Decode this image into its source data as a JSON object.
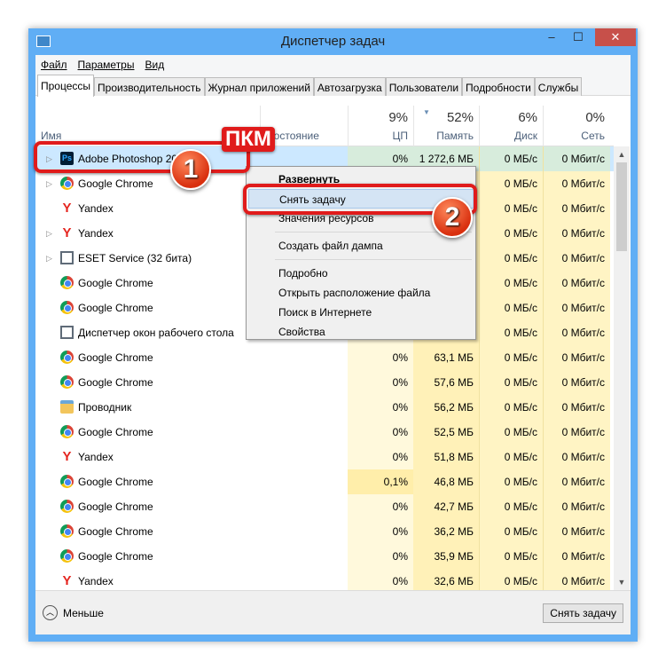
{
  "window": {
    "title": "Диспетчер задач",
    "minimize": "–",
    "maximize": "☐",
    "close": "✕"
  },
  "menu": [
    "Файл",
    "Параметры",
    "Вид"
  ],
  "tabs": [
    "Процессы",
    "Производительность",
    "Журнал приложений",
    "Автозагрузка",
    "Пользователи",
    "Подробности",
    "Службы"
  ],
  "header": {
    "name": "Имя",
    "status": "Состояние",
    "cpu_pct": "9%",
    "cpu": "ЦП",
    "mem_pct": "52%",
    "mem": "Память",
    "disk_pct": "6%",
    "disk": "Диск",
    "net_pct": "0%",
    "net": "Сеть"
  },
  "rows": [
    {
      "name": "Adobe Photoshop 2020",
      "icon": "ps",
      "expand": true,
      "cpu": "0%",
      "mem": "1 272,6 МБ",
      "disk": "0 МБ/с",
      "net": "0 Мбит/с",
      "selected": true
    },
    {
      "name": "Google Chrome",
      "icon": "chrome",
      "expand": true,
      "cpu": "",
      "mem": "",
      "disk": "0 МБ/с",
      "net": "0 Мбит/с"
    },
    {
      "name": "Yandex",
      "icon": "yandex",
      "expand": false,
      "cpu": "",
      "mem": "",
      "disk": "0 МБ/с",
      "net": "0 Мбит/с"
    },
    {
      "name": "Yandex",
      "icon": "yandex",
      "expand": true,
      "cpu": "",
      "mem": "",
      "disk": "0 МБ/с",
      "net": "0 Мбит/с"
    },
    {
      "name": "ESET Service (32 бита)",
      "icon": "app",
      "expand": true,
      "cpu": "",
      "mem": "",
      "disk": "0 МБ/с",
      "net": "0 Мбит/с"
    },
    {
      "name": "Google Chrome",
      "icon": "chrome",
      "expand": false,
      "cpu": "",
      "mem": "",
      "disk": "0 МБ/с",
      "net": "0 Мбит/с"
    },
    {
      "name": "Google Chrome",
      "icon": "chrome",
      "expand": false,
      "cpu": "",
      "mem": "",
      "disk": "0 МБ/с",
      "net": "0 Мбит/с"
    },
    {
      "name": "Диспетчер окон рабочего стола",
      "icon": "app",
      "expand": false,
      "cpu": "",
      "mem": "",
      "disk": "0 МБ/с",
      "net": "0 Мбит/с"
    },
    {
      "name": "Google Chrome",
      "icon": "chrome",
      "expand": false,
      "cpu": "0%",
      "mem": "63,1 МБ",
      "disk": "0 МБ/с",
      "net": "0 Мбит/с"
    },
    {
      "name": "Google Chrome",
      "icon": "chrome",
      "expand": false,
      "cpu": "0%",
      "mem": "57,6 МБ",
      "disk": "0 МБ/с",
      "net": "0 Мбит/с"
    },
    {
      "name": "Проводник",
      "icon": "folder",
      "expand": false,
      "cpu": "0%",
      "mem": "56,2 МБ",
      "disk": "0 МБ/с",
      "net": "0 Мбит/с"
    },
    {
      "name": "Google Chrome",
      "icon": "chrome",
      "expand": false,
      "cpu": "0%",
      "mem": "52,5 МБ",
      "disk": "0 МБ/с",
      "net": "0 Мбит/с"
    },
    {
      "name": "Yandex",
      "icon": "yandex",
      "expand": false,
      "cpu": "0%",
      "mem": "51,8 МБ",
      "disk": "0 МБ/с",
      "net": "0 Мбит/с"
    },
    {
      "name": "Google Chrome",
      "icon": "chrome",
      "expand": false,
      "cpu": "0,1%",
      "mem": "46,8 МБ",
      "disk": "0 МБ/с",
      "net": "0 Мбит/с",
      "hot": true
    },
    {
      "name": "Google Chrome",
      "icon": "chrome",
      "expand": false,
      "cpu": "0%",
      "mem": "42,7 МБ",
      "disk": "0 МБ/с",
      "net": "0 Мбит/с"
    },
    {
      "name": "Google Chrome",
      "icon": "chrome",
      "expand": false,
      "cpu": "0%",
      "mem": "36,2 МБ",
      "disk": "0 МБ/с",
      "net": "0 Мбит/с"
    },
    {
      "name": "Google Chrome",
      "icon": "chrome",
      "expand": false,
      "cpu": "0%",
      "mem": "35,9 МБ",
      "disk": "0 МБ/с",
      "net": "0 Мбит/с"
    },
    {
      "name": "Yandex",
      "icon": "yandex",
      "expand": false,
      "cpu": "0%",
      "mem": "32,6 МБ",
      "disk": "0 МБ/с",
      "net": "0 Мбит/с"
    }
  ],
  "context_menu": [
    {
      "label": "Развернуть",
      "bold": true
    },
    {
      "label": "Снять задачу",
      "highlight": true
    },
    {
      "label": "Значения ресурсов"
    },
    {
      "sep": true
    },
    {
      "label": "Создать файл дампа"
    },
    {
      "sep": true
    },
    {
      "label": "Подробно"
    },
    {
      "label": "Открыть расположение файла"
    },
    {
      "label": "Поиск в Интернете"
    },
    {
      "label": "Свойства"
    }
  ],
  "footer": {
    "less": "Меньше",
    "end_task": "Снять задачу"
  },
  "annotations": {
    "pkm": "ПКМ",
    "step1": "1",
    "step2": "2",
    "color": "#e01b1b"
  }
}
